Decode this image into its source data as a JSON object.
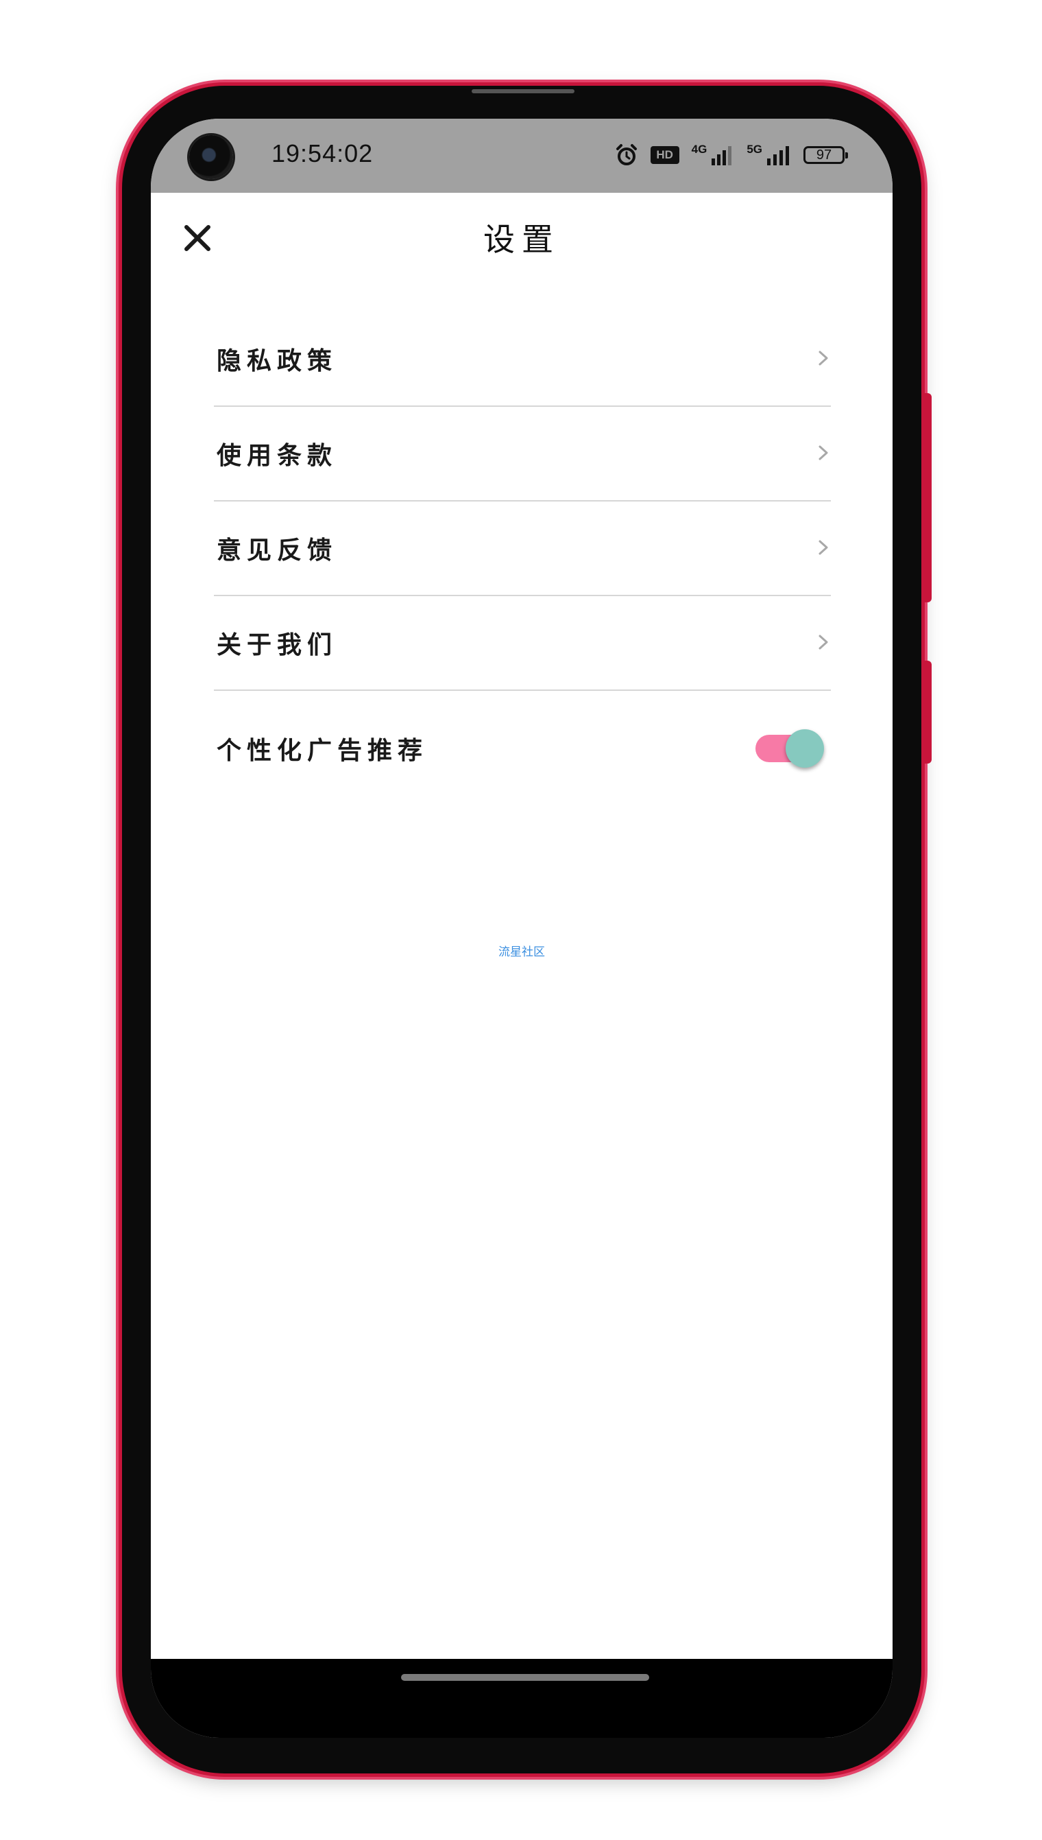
{
  "status_bar": {
    "time": "19:54:02",
    "hd_label": "HD",
    "net_4g": "4G",
    "net_5g": "5G",
    "battery_level": "97"
  },
  "header": {
    "title": "设置"
  },
  "menu": {
    "items": [
      {
        "label": "隐私政策"
      },
      {
        "label": "使用条款"
      },
      {
        "label": "意见反馈"
      },
      {
        "label": "关于我们"
      }
    ],
    "toggle": {
      "label": "个性化广告推荐",
      "enabled": true
    }
  },
  "footer": {
    "link_text": "流星社区"
  },
  "colors": {
    "toggle_track": "#f77aa6",
    "toggle_knob": "#86c9bf",
    "footer_link": "#3b8fe0",
    "frame_accent": "#c8153b"
  }
}
